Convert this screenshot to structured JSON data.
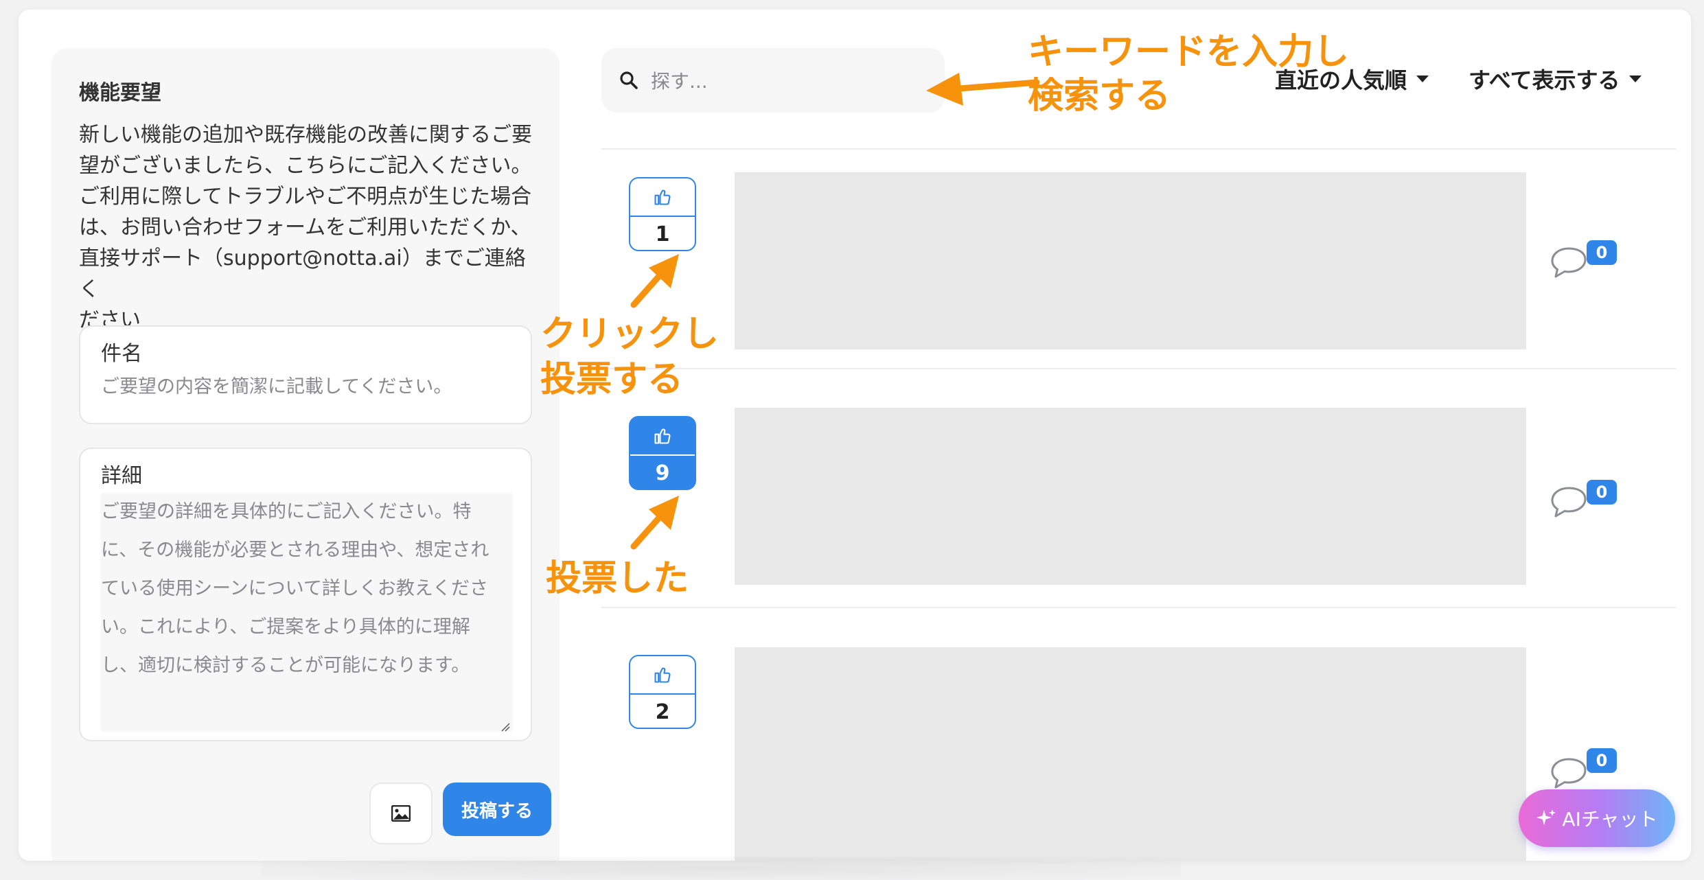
{
  "left_panel": {
    "title": "機能要望",
    "description": "新しい機能の追加や既存機能の改善に関するご要\n望がございましたら、こちらにご記入ください。\nご利用に際してトラブルやご不明点が生じた場合\nは、お問い合わせフォームをご利用いただくか、\n直接サポート（support@notta.ai）までご連絡く\nださい",
    "subject_field": {
      "label": "件名",
      "placeholder": "ご要望の内容を簡潔に記載してください。"
    },
    "detail_field": {
      "label": "詳細",
      "placeholder": "ご要望の詳細を具体的にご記入ください。特\nに、その機能が必要とされる理由や、想定され\nている使用シーンについて詳しくお教えくださ\nい。これにより、ご提案をより具体的に理解\nし、適切に検討することが可能になります。"
    },
    "image_button_icon": "image-icon",
    "submit_label": "投稿する"
  },
  "search": {
    "placeholder": "探す..."
  },
  "sort_dropdown": {
    "label": "直近の人気順"
  },
  "filter_dropdown": {
    "label": "すべて表示する"
  },
  "posts": [
    {
      "votes": "1",
      "voted": false,
      "comments": "0"
    },
    {
      "votes": "9",
      "voted": true,
      "comments": "0"
    },
    {
      "votes": "2",
      "voted": false,
      "comments": "0"
    }
  ],
  "annotations": {
    "search": "キーワードを入力し\n検索する",
    "click": "クリックし\n投票する",
    "voted": "投票した"
  },
  "ai_chat": {
    "label": "AIチャット"
  },
  "colors": {
    "accent": "#2f86e8",
    "annotation": "#f7920c"
  }
}
